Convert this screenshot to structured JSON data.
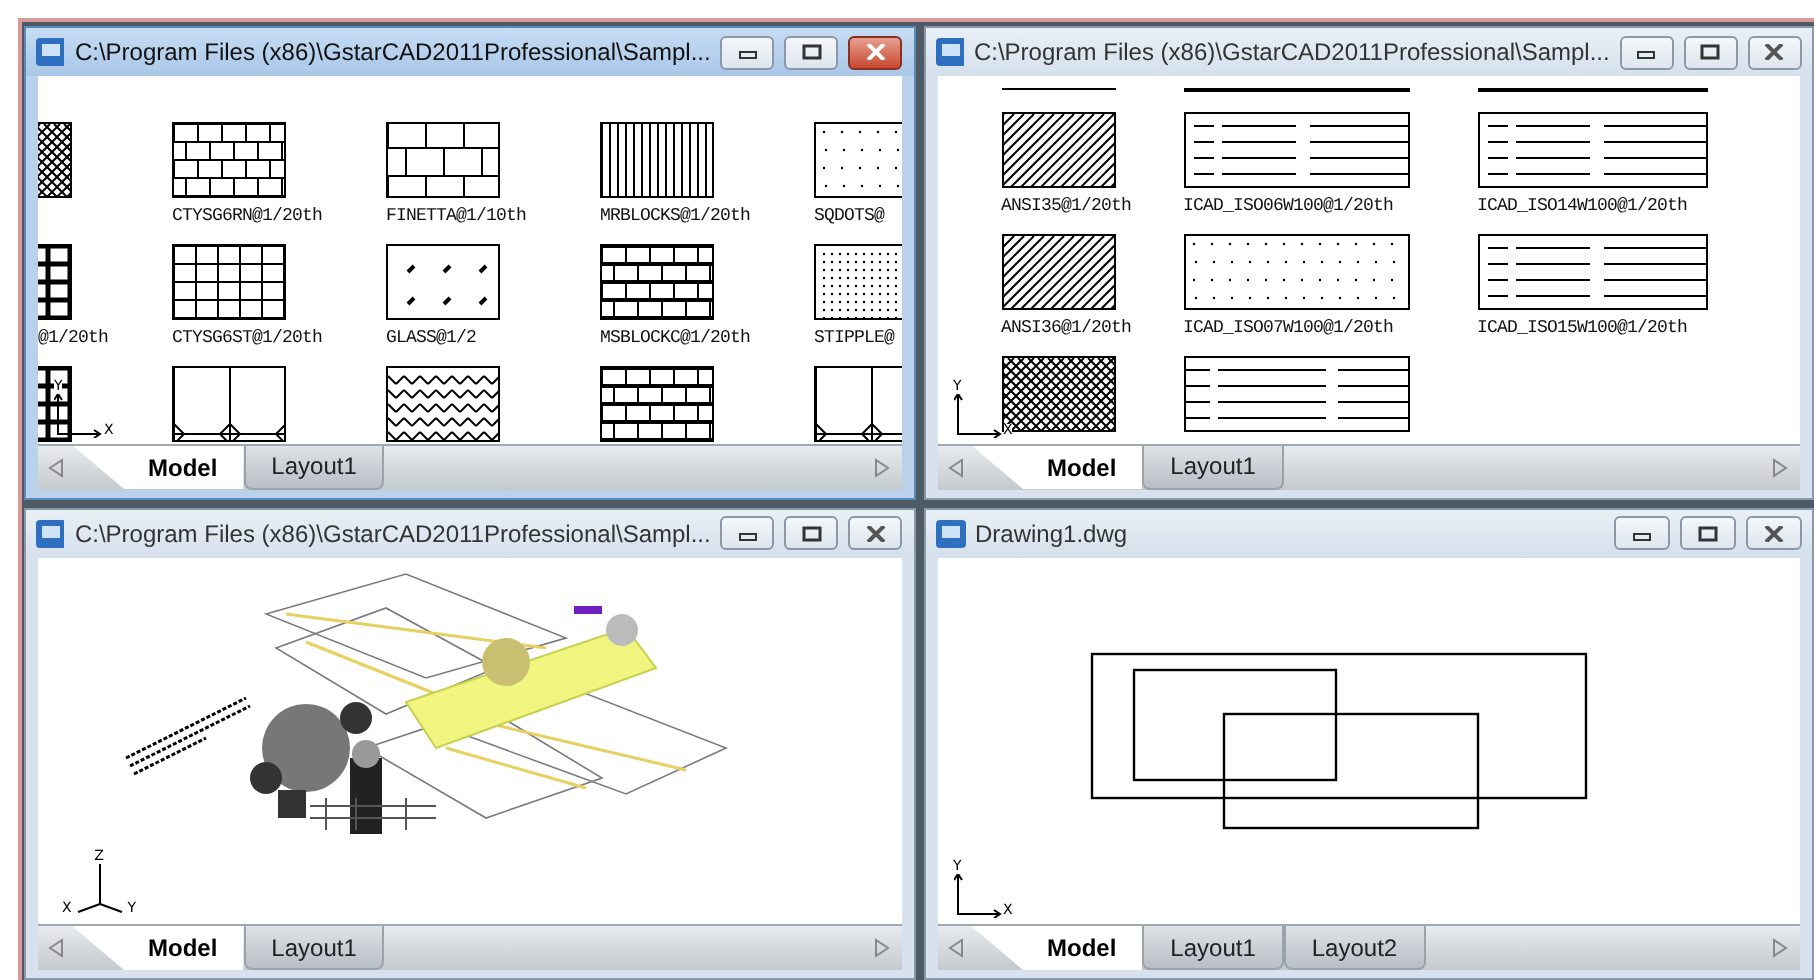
{
  "windows": [
    {
      "title": "C:\\Program Files (x86)\\GstarCAD2011Professional\\Sampl...",
      "active": true,
      "content": {
        "kind": "hatch_gallery",
        "rows": [
          {
            "kind": "skip_first",
            "labels": [
              "CTYSG6RN@1/20th",
              "FINETTA@1/10th",
              "MRBLOCKS@1/20th",
              "SQDOTS@"
            ]
          },
          {
            "kind": "full",
            "labels": [
              "@1/20th",
              "CTYSG6ST@1/20th",
              "GLASS@1/2",
              "MSBLOCKC@1/20th",
              "STIPPLE@"
            ]
          },
          {
            "kind": "unlabeled"
          }
        ]
      },
      "ucs": [
        "Y",
        "X"
      ],
      "tabs": [
        {
          "label": "Model",
          "selected": true
        },
        {
          "label": "Layout1",
          "selected": false
        }
      ]
    },
    {
      "title": "C:\\Program Files (x86)\\GstarCAD2011Professional\\Sampl...",
      "active": false,
      "content": {
        "kind": "hatch_gallery_wide",
        "rows": [
          {
            "kind": "full",
            "labels": [
              "ANSI35@1/20th",
              "ICAD_ISO06W100@1/20th",
              "ICAD_ISO14W100@1/20th"
            ]
          },
          {
            "kind": "full",
            "labels": [
              "ANSI36@1/20th",
              "ICAD_ISO07W100@1/20th",
              "ICAD_ISO15W100@1/20th"
            ]
          },
          {
            "kind": "unlabeled"
          }
        ]
      },
      "ucs": [
        "Y",
        "X"
      ],
      "tabs": [
        {
          "label": "Model",
          "selected": true
        },
        {
          "label": "Layout1",
          "selected": false
        }
      ]
    },
    {
      "title": "C:\\Program Files (x86)\\GstarCAD2011Professional\\Sampl...",
      "active": false,
      "content": {
        "kind": "model_3d"
      },
      "ucs": [
        "Z",
        "X",
        "Y"
      ],
      "tabs": [
        {
          "label": "Model",
          "selected": true
        },
        {
          "label": "Layout1",
          "selected": false
        }
      ]
    },
    {
      "title": "Drawing1.dwg",
      "active": false,
      "content": {
        "kind": "rectangles"
      },
      "ucs": [
        "Y",
        "X"
      ],
      "tabs": [
        {
          "label": "Model",
          "selected": true
        },
        {
          "label": "Layout1",
          "selected": false
        },
        {
          "label": "Layout2",
          "selected": false
        }
      ]
    }
  ]
}
